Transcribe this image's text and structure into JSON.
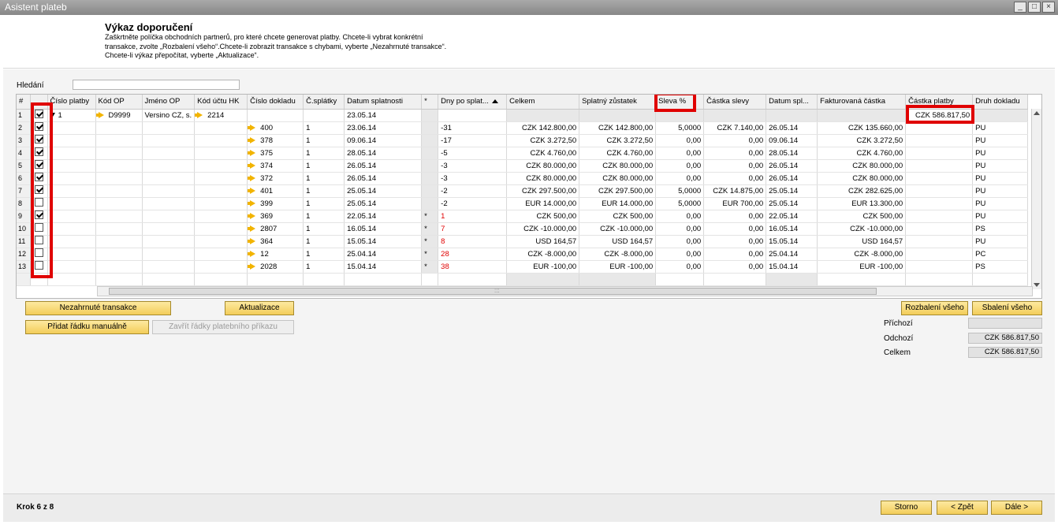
{
  "window": {
    "title": "Asistent plateb",
    "controls": [
      "_",
      "□",
      "×"
    ]
  },
  "header": {
    "title": "Výkaz doporučení",
    "description": "Zaškrtněte políčka obchodních partnerů, pro které chcete generovat platby. Chcete-li vybrat konkrétní transakce, zvolte „Rozbalení všeho“.Chcete-li zobrazit transakce s chybami, vyberte „Nezahrnuté transakce“. Chcete-li výkaz přepočítat, vyberte „Aktualizace“."
  },
  "search": {
    "label": "Hledání",
    "value": ""
  },
  "grid": {
    "columns": [
      "#",
      "",
      "Číslo platby",
      "Kód OP",
      "Jméno OP",
      "Kód účtu HK",
      "Číslo dokladu",
      "Č.splátky",
      "Datum splatnosti",
      "*",
      "Dny po splat...",
      "Celkem",
      "Splatný zůstatek",
      "Sleva %",
      "Částka slevy",
      "Datum spl...",
      "Fakturovaná částka",
      "Částka platby",
      "Druh dokladu"
    ],
    "group_row": {
      "num": "1",
      "checked": true,
      "payment_no": "1",
      "bp_code": "D9999",
      "bp_name": "Versino CZ, s.",
      "gl_code": "2214",
      "due_date": "23.05.14",
      "payment_amount": "CZK 586.817,50"
    },
    "rows": [
      {
        "num": "2",
        "checked": true,
        "doc": "400",
        "inst": "1",
        "due": "23.06.14",
        "star": "",
        "days": "-31",
        "days_red": false,
        "total": "CZK 142.800,00",
        "balance": "CZK 142.800,00",
        "disc_pct": "5,0000",
        "disc_amt": "CZK 7.140,00",
        "disc_date": "26.05.14",
        "invoiced": "CZK 135.660,00",
        "doc_type": "PU"
      },
      {
        "num": "3",
        "checked": true,
        "doc": "378",
        "inst": "1",
        "due": "09.06.14",
        "star": "",
        "days": "-17",
        "days_red": false,
        "total": "CZK 3.272,50",
        "balance": "CZK 3.272,50",
        "disc_pct": "0,00",
        "disc_amt": "0,00",
        "disc_date": "09.06.14",
        "invoiced": "CZK 3.272,50",
        "doc_type": "PU"
      },
      {
        "num": "4",
        "checked": true,
        "doc": "375",
        "inst": "1",
        "due": "28.05.14",
        "star": "",
        "days": "-5",
        "days_red": false,
        "total": "CZK 4.760,00",
        "balance": "CZK 4.760,00",
        "disc_pct": "0,00",
        "disc_amt": "0,00",
        "disc_date": "28.05.14",
        "invoiced": "CZK 4.760,00",
        "doc_type": "PU"
      },
      {
        "num": "5",
        "checked": true,
        "doc": "374",
        "inst": "1",
        "due": "26.05.14",
        "star": "",
        "days": "-3",
        "days_red": false,
        "total": "CZK 80.000,00",
        "balance": "CZK 80.000,00",
        "disc_pct": "0,00",
        "disc_amt": "0,00",
        "disc_date": "26.05.14",
        "invoiced": "CZK 80.000,00",
        "doc_type": "PU"
      },
      {
        "num": "6",
        "checked": true,
        "doc": "372",
        "inst": "1",
        "due": "26.05.14",
        "star": "",
        "days": "-3",
        "days_red": false,
        "total": "CZK 80.000,00",
        "balance": "CZK 80.000,00",
        "disc_pct": "0,00",
        "disc_amt": "0,00",
        "disc_date": "26.05.14",
        "invoiced": "CZK 80.000,00",
        "doc_type": "PU"
      },
      {
        "num": "7",
        "checked": true,
        "doc": "401",
        "inst": "1",
        "due": "25.05.14",
        "star": "",
        "days": "-2",
        "days_red": false,
        "total": "CZK 297.500,00",
        "balance": "CZK 297.500,00",
        "disc_pct": "5,0000",
        "disc_amt": "CZK 14.875,00",
        "disc_date": "25.05.14",
        "invoiced": "CZK 282.625,00",
        "doc_type": "PU"
      },
      {
        "num": "8",
        "checked": false,
        "doc": "399",
        "inst": "1",
        "due": "25.05.14",
        "star": "",
        "days": "-2",
        "days_red": false,
        "total": "EUR 14.000,00",
        "balance": "EUR 14.000,00",
        "disc_pct": "5,0000",
        "disc_amt": "EUR 700,00",
        "disc_date": "25.05.14",
        "invoiced": "EUR 13.300,00",
        "doc_type": "PU"
      },
      {
        "num": "9",
        "checked": true,
        "doc": "369",
        "inst": "1",
        "due": "22.05.14",
        "star": "*",
        "days": "1",
        "days_red": true,
        "total": "CZK 500,00",
        "balance": "CZK 500,00",
        "disc_pct": "0,00",
        "disc_amt": "0,00",
        "disc_date": "22.05.14",
        "invoiced": "CZK 500,00",
        "doc_type": "PU"
      },
      {
        "num": "10",
        "checked": false,
        "doc": "2807",
        "inst": "1",
        "due": "16.05.14",
        "star": "*",
        "days": "7",
        "days_red": true,
        "total": "CZK -10.000,00",
        "balance": "CZK -10.000,00",
        "disc_pct": "0,00",
        "disc_amt": "0,00",
        "disc_date": "16.05.14",
        "invoiced": "CZK -10.000,00",
        "doc_type": "PS"
      },
      {
        "num": "11",
        "checked": false,
        "doc": "364",
        "inst": "1",
        "due": "15.05.14",
        "star": "*",
        "days": "8",
        "days_red": true,
        "total": "USD 164,57",
        "balance": "USD 164,57",
        "disc_pct": "0,00",
        "disc_amt": "0,00",
        "disc_date": "15.05.14",
        "invoiced": "USD 164,57",
        "doc_type": "PU"
      },
      {
        "num": "12",
        "checked": false,
        "doc": "12",
        "inst": "1",
        "due": "25.04.14",
        "star": "*",
        "days": "28",
        "days_red": true,
        "total": "CZK -8.000,00",
        "balance": "CZK -8.000,00",
        "disc_pct": "0,00",
        "disc_amt": "0,00",
        "disc_date": "25.04.14",
        "invoiced": "CZK -8.000,00",
        "doc_type": "PC"
      },
      {
        "num": "13",
        "checked": false,
        "doc": "2028",
        "inst": "1",
        "due": "15.04.14",
        "star": "*",
        "days": "38",
        "days_red": true,
        "total": "EUR -100,00",
        "balance": "EUR -100,00",
        "disc_pct": "0,00",
        "disc_amt": "0,00",
        "disc_date": "15.04.14",
        "invoiced": "EUR -100,00",
        "doc_type": "PS"
      }
    ],
    "scroll_grip": ":::"
  },
  "buttons": {
    "excluded": "Nezahrnuté transakce",
    "refresh": "Aktualizace",
    "add_manual": "Přidat řádku manuálně",
    "close_rows": "Zavřít řádky platebního příkazu",
    "expand_all": "Rozbalení všeho",
    "collapse_all": "Sbalení všeho"
  },
  "totals": {
    "incoming_label": "Příchozí",
    "incoming_value": "",
    "outgoing_label": "Odchozí",
    "outgoing_value": "CZK 586.817,50",
    "total_label": "Celkem",
    "total_value": "CZK 586.817,50"
  },
  "footer": {
    "step": "Krok 6 z 8",
    "cancel": "Storno",
    "back": "< Zpět",
    "next": "Dále >"
  },
  "colors": {
    "highlight": "#e00000",
    "button": "#f3cd5a",
    "negative_days": "#e00000"
  }
}
